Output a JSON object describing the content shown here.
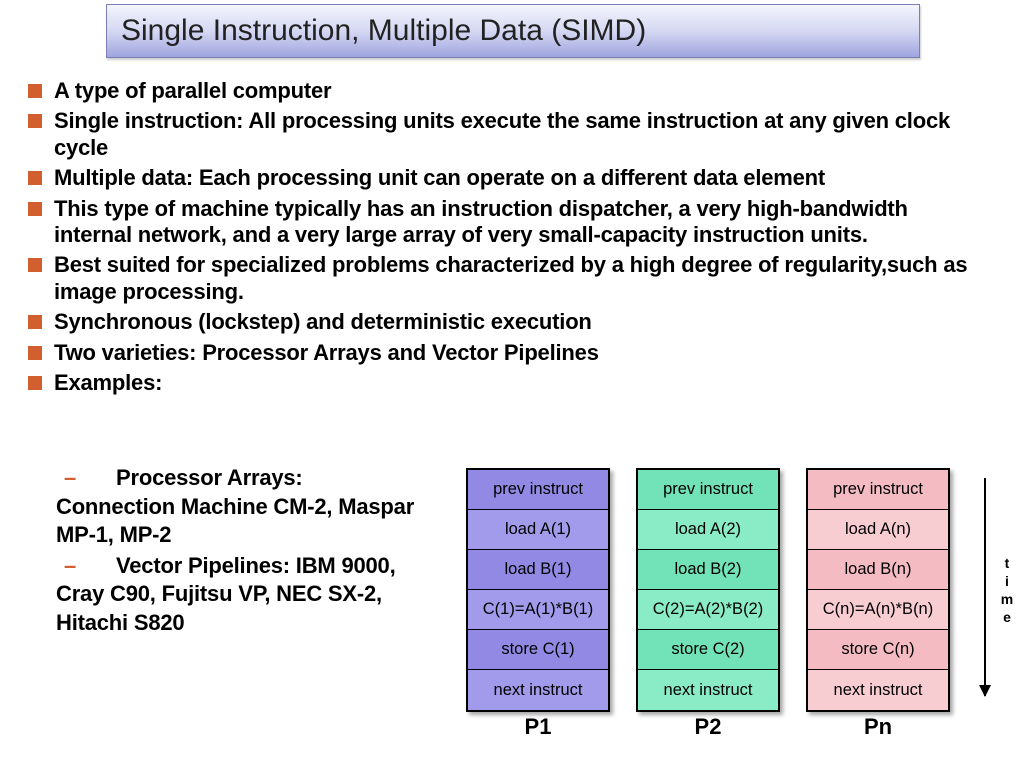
{
  "title": "Single Instruction, Multiple Data (SIMD)",
  "bullets": [
    "A type of parallel computer",
    "Single instruction: All processing units execute the same instruction at any given clock cycle",
    "Multiple data: Each processing unit can operate on a different data element",
    "This type of machine typically has an instruction dispatcher, a very high-bandwidth internal network, and a very large array of very small-capacity instruction units.",
    "Best suited for specialized problems characterized by a high degree of regularity,such as image processing.",
    "Synchronous (lockstep) and deterministic execution",
    "Two varieties: Processor Arrays and Vector Pipelines",
    "Examples:"
  ],
  "sub": {
    "pa_label": "Processor Arrays:",
    "pa_body": "Connection Machine CM-2, Maspar MP-1, MP-2",
    "vp_label": "Vector Pipelines: IBM 9000,",
    "vp_body": "Cray C90, Fujitsu VP, NEC SX-2, Hitachi S820"
  },
  "timeLabel": "time",
  "processors": [
    {
      "color": "purple",
      "label": "P1",
      "cells": [
        "prev instruct",
        "load A(1)",
        "load B(1)",
        "C(1)=A(1)*B(1)",
        "store C(1)",
        "next instruct"
      ]
    },
    {
      "color": "green",
      "label": "P2",
      "cells": [
        "prev instruct",
        "load A(2)",
        "load B(2)",
        "C(2)=A(2)*B(2)",
        "store C(2)",
        "next instruct"
      ]
    },
    {
      "color": "pink",
      "label": "Pn",
      "cells": [
        "prev instruct",
        "load A(n)",
        "load B(n)",
        "C(n)=A(n)*B(n)",
        "store C(n)",
        "next instruct"
      ]
    }
  ]
}
